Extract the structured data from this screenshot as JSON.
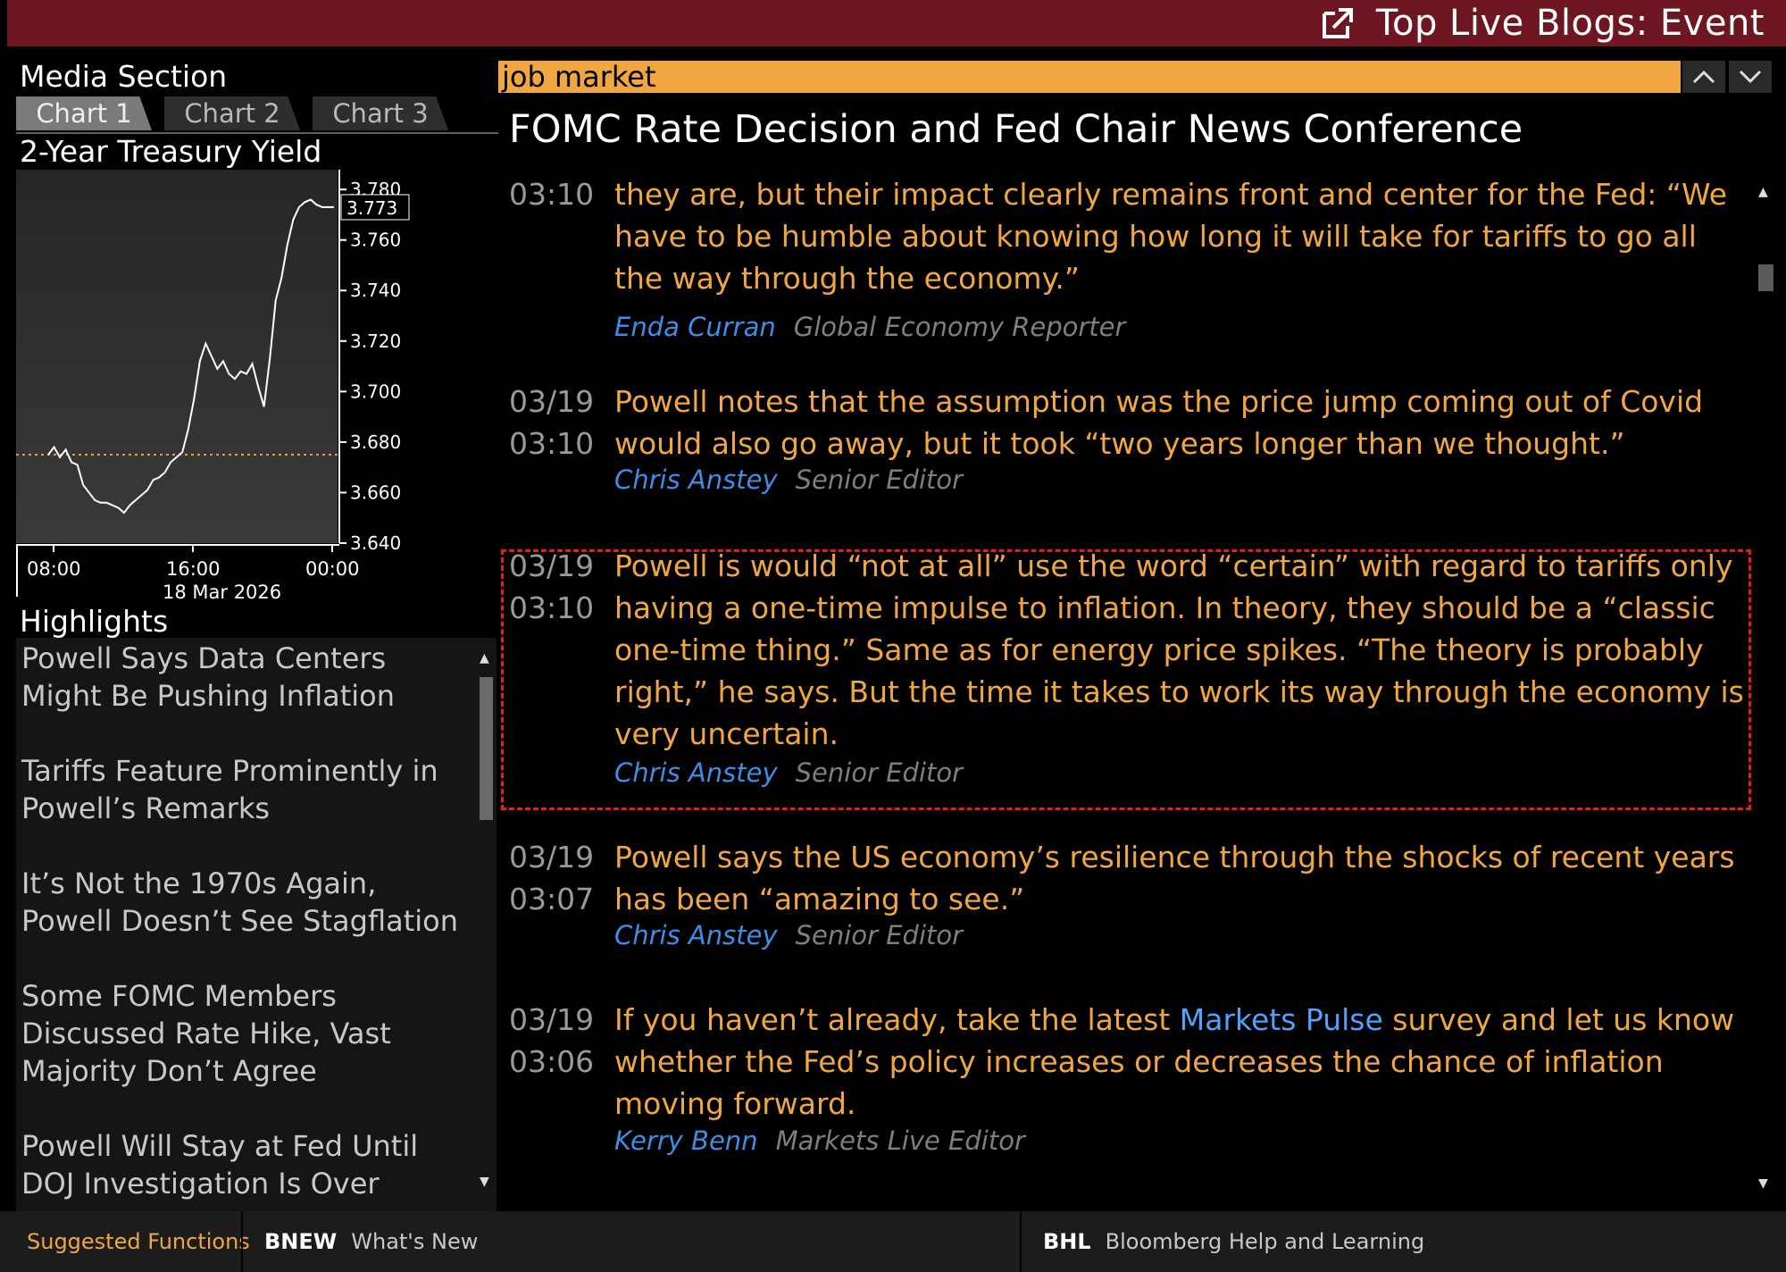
{
  "window": {
    "title": "Top Live Blogs: Event",
    "popout_icon": "external-link-icon"
  },
  "media": {
    "section_title": "Media Section",
    "tabs": [
      {
        "label": "Chart 1",
        "active": true
      },
      {
        "label": "Chart 2",
        "active": false
      },
      {
        "label": "Chart 3",
        "active": false
      }
    ],
    "chart_title": "2-Year Treasury Yield"
  },
  "chart_data": {
    "type": "line",
    "title": "2-Year Treasury Yield",
    "date_label": "18 Mar 2026",
    "x_ticks": [
      "08:00",
      "16:00",
      "00:00"
    ],
    "y_ticks": [
      3.78,
      3.76,
      3.74,
      3.72,
      3.7,
      3.68,
      3.66,
      3.64
    ],
    "y_tick_labels": [
      "3.780",
      "3.760",
      "3.740",
      "3.720",
      "3.700",
      "3.680",
      "3.660",
      "3.640"
    ],
    "ylim": [
      3.64,
      3.785
    ],
    "last_value_label": "3.773",
    "reference_line": 3.675,
    "series": [
      {
        "color": "#ffffff",
        "x": [
          "06:00",
          "06:30",
          "07:00",
          "07:30",
          "08:00",
          "08:30",
          "09:00",
          "09:30",
          "10:00",
          "10:30",
          "11:00",
          "11:30",
          "12:00",
          "12:30",
          "13:00",
          "13:30",
          "14:00",
          "14:30",
          "15:00",
          "15:30",
          "16:00",
          "16:30",
          "17:00",
          "17:30",
          "18:00",
          "18:30",
          "19:00",
          "19:30",
          "20:00",
          "20:30",
          "21:00",
          "21:30",
          "22:00",
          "22:30",
          "23:00",
          "23:30",
          "00:00",
          "00:30",
          "01:00",
          "01:30",
          "02:00",
          "02:30",
          "03:00",
          "03:30",
          "04:00",
          "04:30",
          "05:00",
          "05:30",
          "06:00",
          "06:30"
        ],
        "y": [
          3.675,
          3.678,
          3.674,
          3.677,
          3.672,
          3.671,
          3.663,
          3.66,
          3.657,
          3.656,
          3.656,
          3.655,
          3.654,
          3.652,
          3.655,
          3.657,
          3.659,
          3.661,
          3.665,
          3.666,
          3.668,
          3.672,
          3.674,
          3.676,
          3.685,
          3.697,
          3.712,
          3.719,
          3.714,
          3.709,
          3.712,
          3.707,
          3.705,
          3.708,
          3.707,
          3.711,
          3.702,
          3.694,
          3.713,
          3.736,
          3.745,
          3.758,
          3.768,
          3.773,
          3.775,
          3.776,
          3.774,
          3.773,
          3.773,
          3.773
        ]
      }
    ]
  },
  "highlights": {
    "title": "Highlights",
    "items": [
      "Powell Says Data Centers Might Be Pushing Inflation",
      "Tariffs Feature Prominently in Powell’s Remarks",
      "It’s Not the 1970s Again, Powell Doesn’t See Stagflation",
      "Some FOMC Members Discussed Rate Hike, Vast Majority Don’t Agree",
      "Powell Will Stay at Fed Until DOJ Investigation Is Over"
    ]
  },
  "search": {
    "value": "job market"
  },
  "blog": {
    "headline": "FOMC Rate Decision and Fed Chair News Conference",
    "entries": [
      {
        "date": "",
        "time": "03:10",
        "text": "they are, but their impact clearly remains front and center for the Fed: “We have to be humble about knowing how long it will take for tariffs to go all the way through the economy.”",
        "author": "Enda Curran",
        "role": "Global Economy Reporter"
      },
      {
        "date": "03/19",
        "time": "03:10",
        "text": "Powell notes that the assumption was the price jump coming out of Covid would also go away, but it took “two years longer than we thought.”",
        "author": "Chris Anstey",
        "role": "Senior Editor"
      },
      {
        "date": "03/19",
        "time": "03:10",
        "text": "Powell is would “not at all” use the word “certain” with regard to tariffs only having a one-time impulse to inflation. In theory, they should be a “classic one-time thing.” Same as for energy price spikes. “The theory is probably right,” he says. But the time it takes to work its way through the economy is very uncertain.",
        "author": "Chris Anstey",
        "role": "Senior Editor"
      },
      {
        "date": "03/19",
        "time": "03:07",
        "text": "Powell says the US economy’s resilience through the shocks of recent years has been “amazing to see.”",
        "author": "Chris Anstey",
        "role": "Senior Editor"
      },
      {
        "date": "03/19",
        "time": "03:06",
        "text_before": "If you haven’t already, take the latest ",
        "link": "Markets Pulse",
        "text_after": " survey and let us know whether the Fed’s policy increases or decreases the chance of inflation moving forward.",
        "author": "Kerry Benn",
        "role": "Markets Live Editor"
      }
    ]
  },
  "footer": {
    "suggested": "Suggested Functions",
    "items": [
      {
        "code": "BNEW",
        "label": "What's New"
      },
      {
        "code": "BHL",
        "label": "Bloomberg Help and Learning"
      }
    ]
  },
  "colors": {
    "title_bar": "#6e1722",
    "search_bg": "#f0a742",
    "entry_text": "#f0a742",
    "author_name": "#3d8fe6",
    "link": "#4fa3ff",
    "highlight_border": "#e02020"
  }
}
